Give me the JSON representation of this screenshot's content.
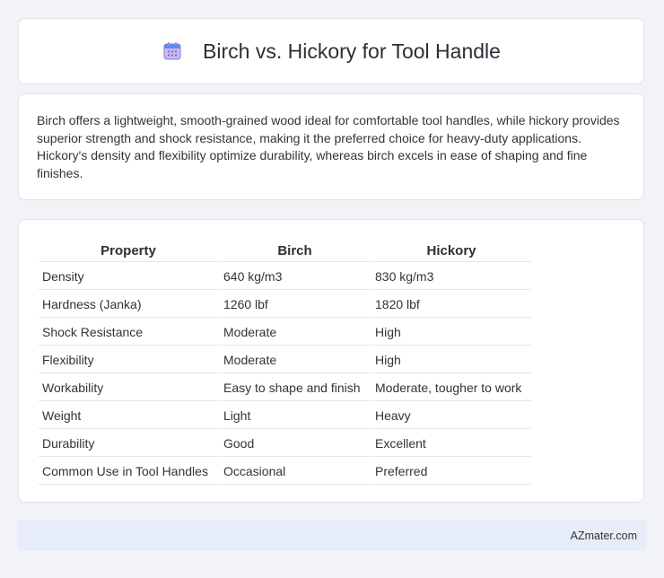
{
  "header": {
    "icon": "calendar-icon",
    "title": "Birch vs. Hickory for Tool Handle"
  },
  "description": "Birch offers a lightweight, smooth-grained wood ideal for comfortable tool handles, while hickory provides superior strength and shock resistance, making it the preferred choice for heavy-duty applications. Hickory's density and flexibility optimize durability, whereas birch excels in ease of shaping and fine finishes.",
  "table": {
    "headers": [
      "Property",
      "Birch",
      "Hickory"
    ],
    "rows": [
      [
        "Density",
        "640 kg/m3",
        "830 kg/m3"
      ],
      [
        "Hardness (Janka)",
        "1260 lbf",
        "1820 lbf"
      ],
      [
        "Shock Resistance",
        "Moderate",
        "High"
      ],
      [
        "Flexibility",
        "Moderate",
        "High"
      ],
      [
        "Workability",
        "Easy to shape and finish",
        "Moderate, tougher to work"
      ],
      [
        "Weight",
        "Light",
        "Heavy"
      ],
      [
        "Durability",
        "Good",
        "Excellent"
      ],
      [
        "Common Use in Tool Handles",
        "Occasional",
        "Preferred"
      ]
    ]
  },
  "footer": {
    "brand": "AZmater.com"
  }
}
